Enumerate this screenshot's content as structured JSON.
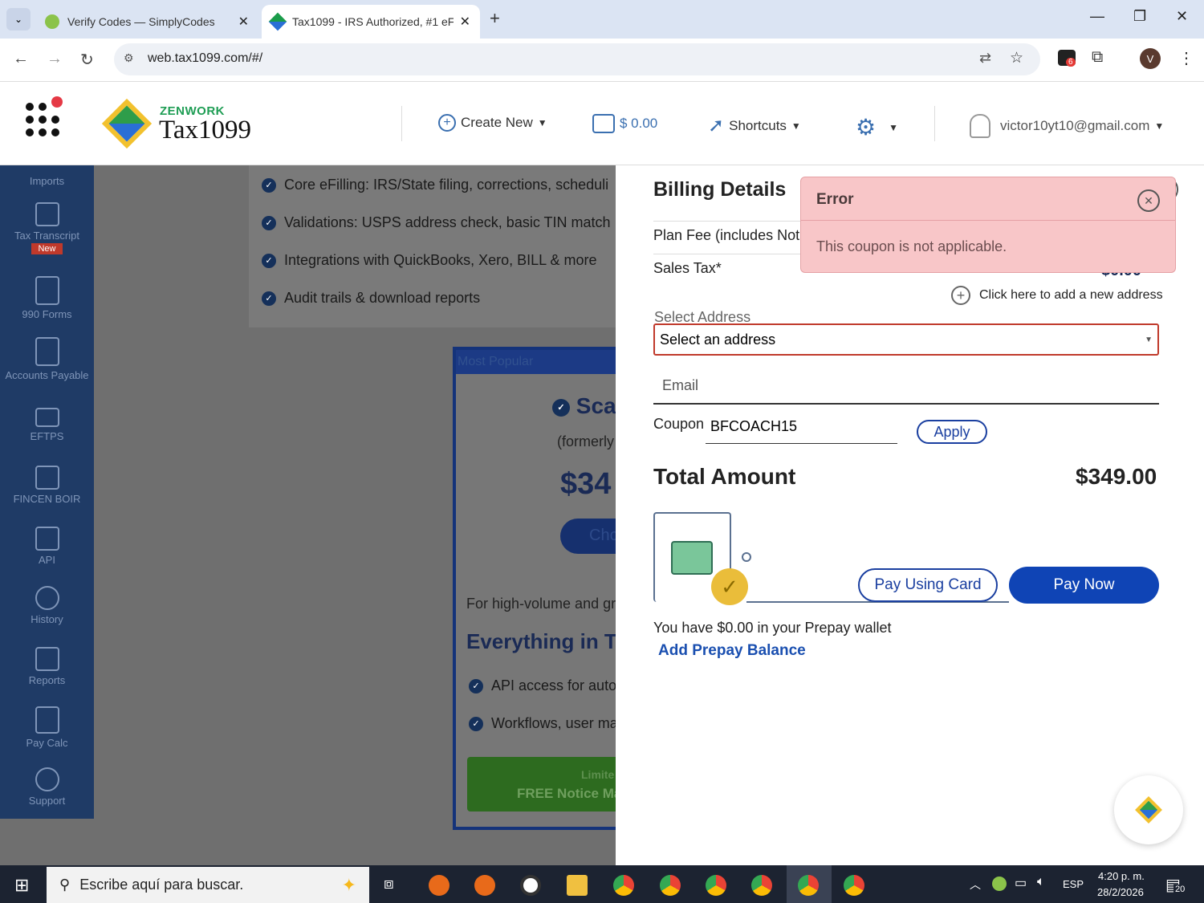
{
  "browser": {
    "tabs": [
      {
        "title": "Verify Codes — SimplyCodes"
      },
      {
        "title": "Tax1099 - IRS Authorized, #1 eF"
      }
    ],
    "url": "web.tax1099.com/#/",
    "profile_initial": "V",
    "ext_badge": "6"
  },
  "header": {
    "brand_top": "ZENWORK",
    "brand_main": "Tax1099",
    "create_new": "Create New",
    "wallet_amount": "$ 0.00",
    "shortcuts": "Shortcuts",
    "user_email": "victor10yt10@gmail.com"
  },
  "sidebar": {
    "items": [
      {
        "label": "Imports"
      },
      {
        "label": "Tax Transcript",
        "badge": "New"
      },
      {
        "label": "990 Forms"
      },
      {
        "label": "Accounts Payable"
      },
      {
        "label": "EFTPS"
      },
      {
        "label": "FINCEN BOIR"
      },
      {
        "label": "API"
      },
      {
        "label": "History"
      },
      {
        "label": "Reports"
      },
      {
        "label": "Pay Calc"
      },
      {
        "label": "Support"
      }
    ]
  },
  "background": {
    "features": [
      "Core eFilling: IRS/State filing, corrections, scheduli",
      "Validations: USPS address check, basic TIN match",
      "Integrations with QuickBooks, Xero, BILL & more",
      "Audit trails & download reports"
    ],
    "card_ribbon": "Most Popular",
    "card_title": "Sca",
    "card_sub": "(formerly",
    "card_price": "$34",
    "card_btn": "Cho",
    "card_desc": "For high-volume and gr",
    "card_heading": "Everything in Tea",
    "card_features": [
      "API access for auto",
      "Workflows, user ma"
    ],
    "banner_line1": "Limite",
    "banner_line2": "FREE Notice Man"
  },
  "billing": {
    "title": "Billing Details",
    "plan_fee_label": "Plan Fee (includes Not",
    "sales_tax_label": "Sales Tax*",
    "sales_tax_value": "$0.00",
    "add_address": "Click here to add a new address",
    "select_address_label": "Select Address",
    "select_address_value": "Select an address",
    "email_label": "Email",
    "coupon_label": "Coupon",
    "coupon_value": "BFCOACH15",
    "apply": "Apply",
    "total_label": "Total Amount",
    "total_value": "$349.00",
    "pay_card": "Pay Using Card",
    "pay_now": "Pay Now",
    "wallet_text": "You have $0.00 in your Prepay wallet",
    "add_prepay": "Add Prepay Balance"
  },
  "error": {
    "title": "Error",
    "message": "This coupon is not applicable."
  },
  "taskbar": {
    "search_placeholder": "Escribe aquí para buscar.",
    "lang": "ESP",
    "time": "4:20 p. m.",
    "date": "28/2/2026",
    "notif_count": "20"
  },
  "colors": {
    "primary": "#0f44b5",
    "sidebar": "#1f3b66",
    "error_bg": "#f8c6c8"
  }
}
